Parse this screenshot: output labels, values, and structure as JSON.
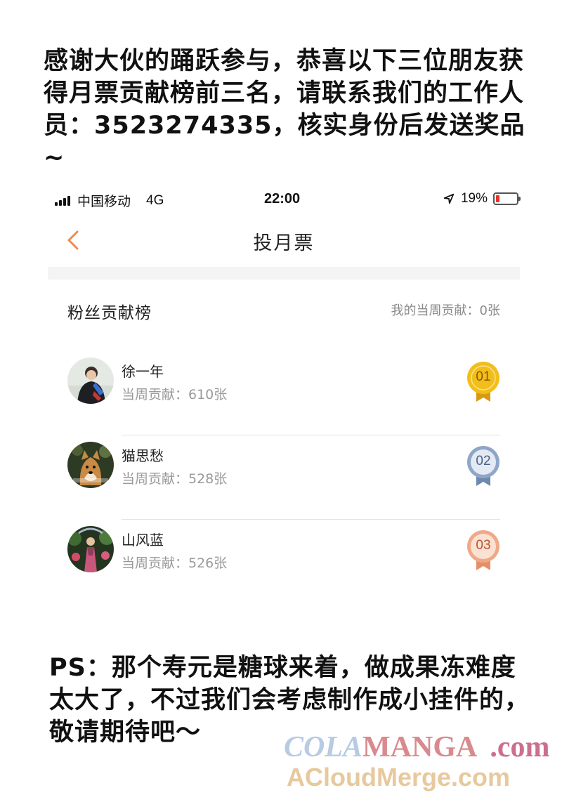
{
  "intro_text": "感谢大伙的踊跃参与，恭喜以下三位朋友获得月票贡献榜前三名，请联系我们的工作人员：3523274335，核实身份后发送奖品~",
  "status_bar": {
    "carrier": "中国移动",
    "network": "4G",
    "time": "22:00",
    "battery": "19%",
    "battery_level": 0.19,
    "battery_color": "#e8332d",
    "icons": [
      "signal-bars-icon",
      "location-arrow-icon",
      "battery-icon"
    ]
  },
  "nav": {
    "title": "投月票",
    "back_icon": "chevron-left-icon",
    "accent_color": "#f0894f"
  },
  "section": {
    "title": "粉丝贡献榜",
    "my_contribution": "我的当周贡献：0张"
  },
  "ranking": [
    {
      "name": "徐一年",
      "contribution": "当周贡献：610张",
      "medal": "01",
      "medal_color": "#f2be1a",
      "avatar_icon": "person-avatar-icon"
    },
    {
      "name": "猫思愁",
      "contribution": "当周贡献：528张",
      "medal": "02",
      "medal_color": "#8fa6c6",
      "avatar_icon": "dog-avatar-icon"
    },
    {
      "name": "山风蓝",
      "contribution": "当周贡献：526张",
      "medal": "03",
      "medal_color": "#f0a987",
      "avatar_icon": "garden-avatar-icon"
    }
  ],
  "ps_text": "PS：那个寿元是糖球来着，做成果冻难度太大了，不过我们会考虑制作成小挂件的，敬请期待吧～",
  "watermark": {
    "line1_a": "COLA",
    "line1_b": "MANGA",
    "line1_c": ".com",
    "line2": "ACloudMerge.com"
  }
}
